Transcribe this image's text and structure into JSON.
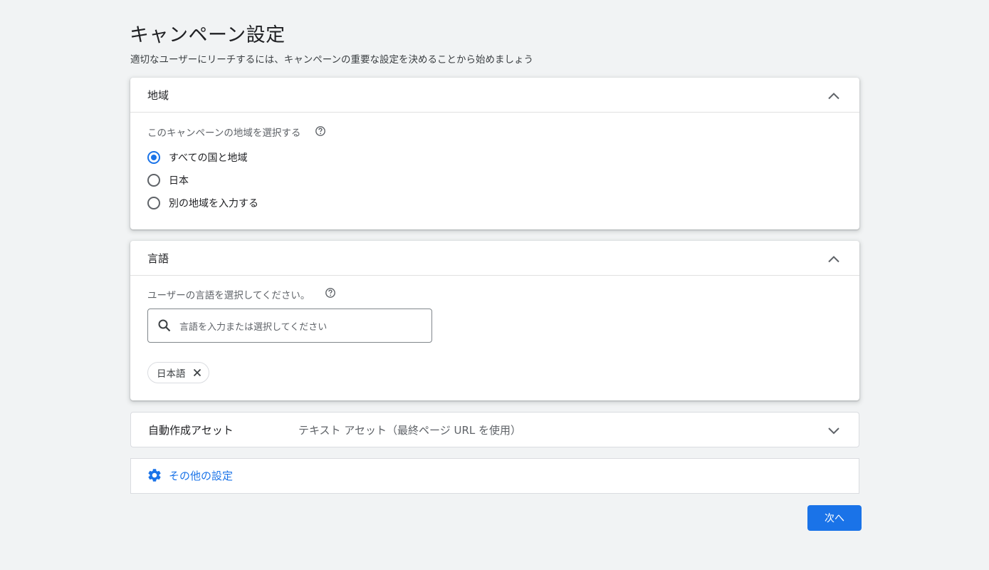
{
  "page": {
    "title": "キャンペーン設定",
    "subtitle": "適切なユーザーにリーチするには、キャンペーンの重要な設定を決めることから始めましょう"
  },
  "location": {
    "title": "地域",
    "expanded": true,
    "label": "このキャンペーンの地域を選択する",
    "options": [
      {
        "label": "すべての国と地域",
        "checked": true
      },
      {
        "label": "日本",
        "checked": false
      },
      {
        "label": "別の地域を入力する",
        "checked": false
      }
    ]
  },
  "language": {
    "title": "言語",
    "expanded": true,
    "label": "ユーザーの言語を選択してください。",
    "search_placeholder": "言語を入力または選択してください",
    "search_value": "",
    "selected_chips": [
      "日本語"
    ]
  },
  "assets": {
    "title": "自動作成アセット",
    "value": "テキスト アセット（最終ページ URL を使用）",
    "expanded": false
  },
  "other_settings": {
    "label": "その他の設定"
  },
  "footer": {
    "next_label": "次へ"
  },
  "colors": {
    "accent": "#1a73e8",
    "background": "#f1f3f4",
    "text_primary": "#202124",
    "text_secondary": "#5f6368"
  },
  "icons": {
    "collapse": "chevron-up-icon",
    "expand": "chevron-down-icon",
    "help": "help-circle-icon",
    "search": "search-icon",
    "chip_remove": "close-icon",
    "other_settings": "gear-icon"
  }
}
